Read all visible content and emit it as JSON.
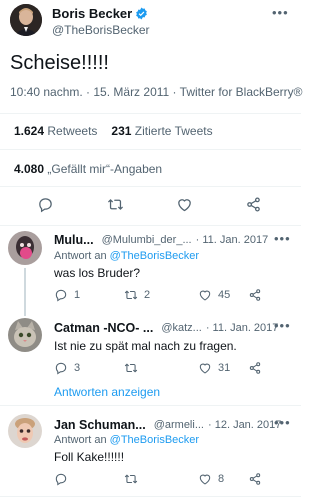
{
  "main_tweet": {
    "author": {
      "name": "Boris Becker",
      "handle": "@TheBorisBecker"
    },
    "text": "Scheise!!!!!",
    "meta": "10:40 nachm. · 15. März 2011 · Twitter for BlackBerry®",
    "stats": {
      "retweets_count": "1.624",
      "retweets_label": "Retweets",
      "quotes_count": "231",
      "quotes_label": "Zitierte Tweets",
      "likes_count": "4.080",
      "likes_label": "„Gefällt mir“-Angaben"
    }
  },
  "replies": [
    {
      "name": "Mulu...",
      "handle": "@Mulumbi_der_...",
      "date": "· 11. Jan. 2017",
      "reply_to_label": "Antwort an",
      "reply_to_handle": "@TheBorisBecker",
      "text": "was los Bruder?",
      "reply_count": "1",
      "retweet_count": "2",
      "like_count": "45"
    },
    {
      "name": "Catman -NCO- ...",
      "handle": "@katz...",
      "date": "· 11. Jan. 2017",
      "text": "Ist nie zu spät mal nach zu fragen.",
      "reply_count": "3",
      "retweet_count": "",
      "like_count": "31"
    },
    {
      "name": "Jan Schuman...",
      "handle": "@armeli...",
      "date": "· 12. Jan. 2017",
      "reply_to_label": "Antwort an",
      "reply_to_handle": "@TheBorisBecker",
      "text": "Foll Kake!!!!!!",
      "reply_count": "",
      "retweet_count": "",
      "like_count": "8"
    }
  ],
  "show_replies_label": "Antworten anzeigen",
  "colors": {
    "accent": "#1d9bf0",
    "text": "#0f1419",
    "muted": "#536471",
    "divider": "#eff3f4"
  }
}
